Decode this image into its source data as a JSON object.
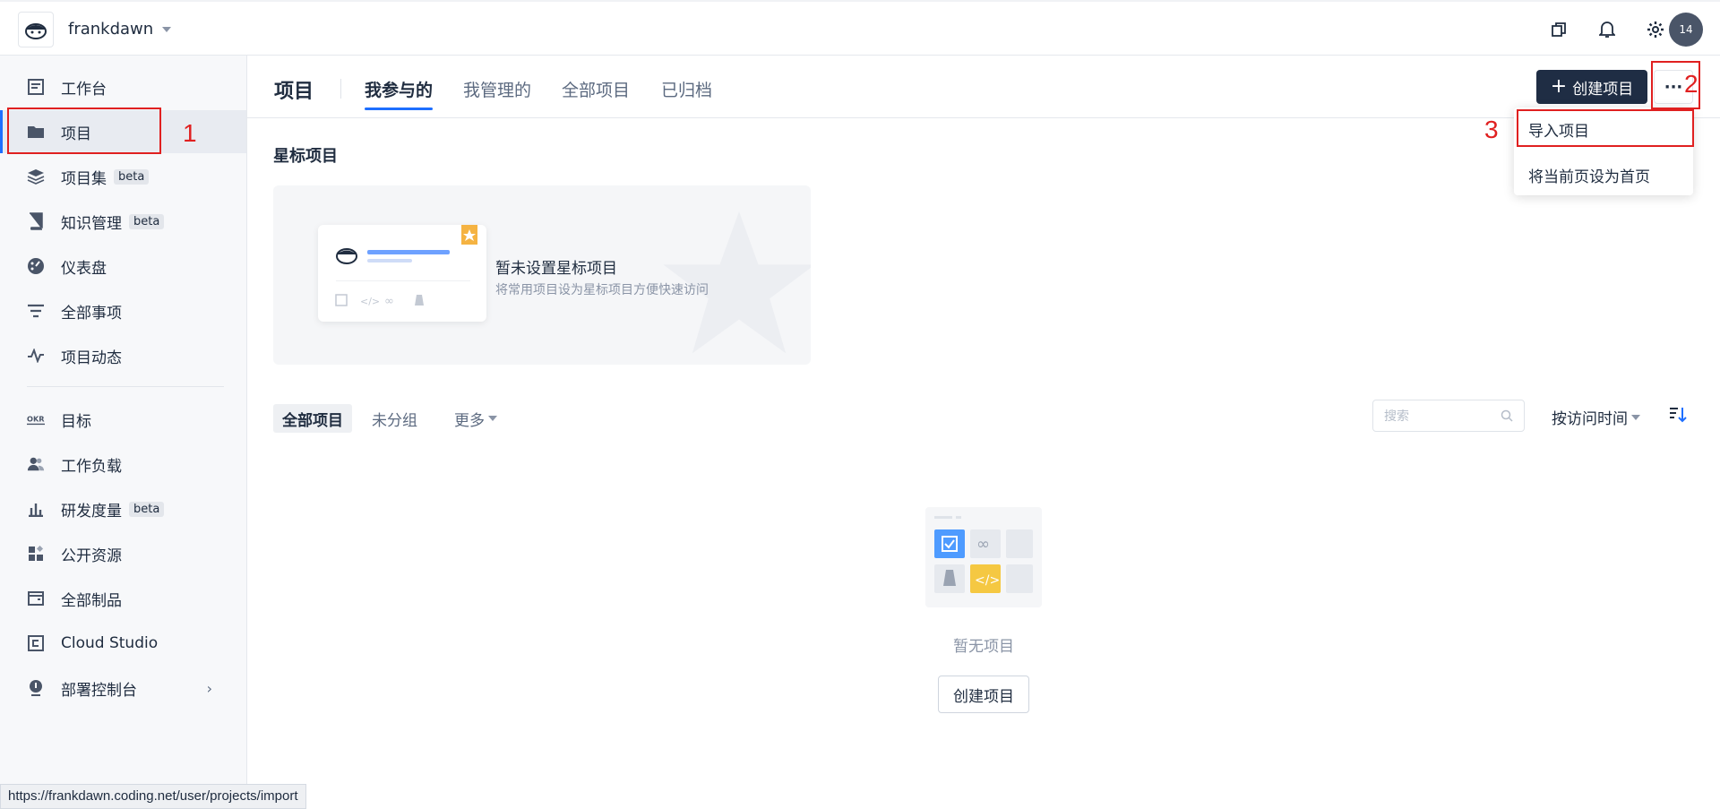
{
  "topbar": {
    "team_name": "frankdawn",
    "avatar_text": "14"
  },
  "sidebar": {
    "items": [
      {
        "label": "工作台",
        "icon": "dashboard-icon"
      },
      {
        "label": "项目",
        "icon": "folder-icon",
        "active": true
      },
      {
        "label": "项目集",
        "icon": "layers-icon",
        "badge": "beta"
      },
      {
        "label": "知识管理",
        "icon": "book-icon",
        "badge": "beta"
      },
      {
        "label": "仪表盘",
        "icon": "gauge-icon"
      },
      {
        "label": "全部事项",
        "icon": "filter-icon"
      },
      {
        "label": "项目动态",
        "icon": "activity-icon"
      },
      {
        "label": "目标",
        "icon": "okr-icon"
      },
      {
        "label": "工作负载",
        "icon": "users-icon"
      },
      {
        "label": "研发度量",
        "icon": "bar-chart-icon",
        "badge": "beta"
      },
      {
        "label": "公开资源",
        "icon": "grid-icon"
      },
      {
        "label": "全部制品",
        "icon": "box-icon"
      },
      {
        "label": "Cloud Studio",
        "icon": "cloud-studio-icon"
      },
      {
        "label": "部署控制台",
        "icon": "deploy-icon"
      }
    ]
  },
  "header": {
    "title": "项目",
    "tabs": [
      {
        "label": "我参与的",
        "active": true
      },
      {
        "label": "我管理的"
      },
      {
        "label": "全部项目"
      },
      {
        "label": "已归档"
      }
    ],
    "create_button": "创建项目",
    "more_button": "···"
  },
  "dropdown": {
    "items": [
      "导入项目",
      "将当前页设为首页"
    ]
  },
  "annotations": [
    "1",
    "2",
    "3"
  ],
  "starred": {
    "title": "星标项目",
    "empty_title": "暂未设置星标项目",
    "empty_sub": "将常用项目设为星标项目方便快速访问"
  },
  "filter": {
    "tabs": [
      "全部项目",
      "未分组",
      "更多"
    ],
    "search_placeholder": "搜索",
    "sort_label": "按访问时间"
  },
  "empty": {
    "text": "暂无项目",
    "button": "创建项目"
  },
  "status_url": "https://frankdawn.coding.net/user/projects/import",
  "colors": {
    "accent": "#1e6fff",
    "primary_button": "#1f2d44",
    "annotation": "#e02020"
  }
}
